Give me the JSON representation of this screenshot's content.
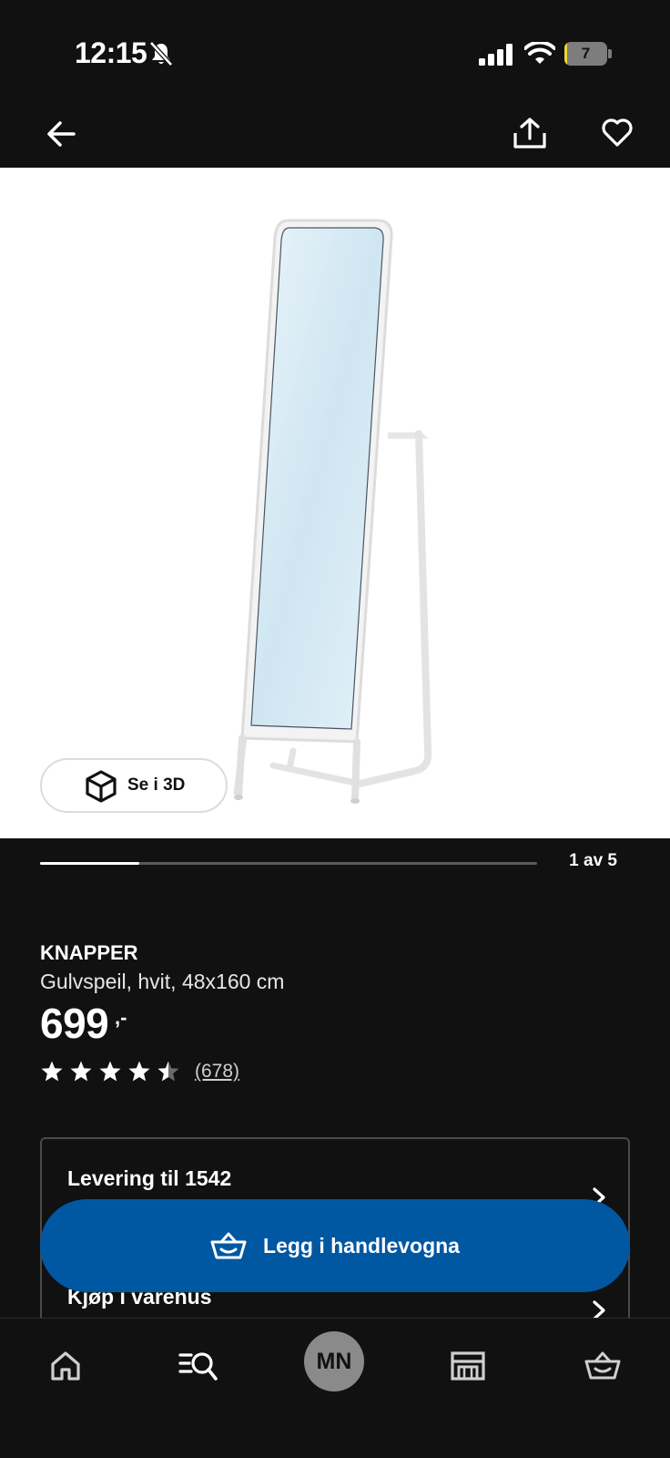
{
  "status_bar": {
    "time": "12:15",
    "battery_level": "7",
    "battery_fraction": 0.07,
    "icons": [
      "bell-off-icon",
      "signal-icon",
      "wifi-icon",
      "battery-icon"
    ]
  },
  "top_bar": {
    "icons": [
      "arrow-left-icon",
      "share-icon",
      "heart-icon"
    ]
  },
  "gallery": {
    "view_3d_label": "Se i 3D",
    "view_3d_icon": "cube-icon",
    "counter": "1 av 5",
    "progress_fraction": 0.2
  },
  "product": {
    "name": "KNAPPER",
    "description": "Gulvspeil, hvit, 48x160 cm",
    "price": "699",
    "price_suffix": ",-",
    "rating_value": 4.5,
    "rating_count": "(678)"
  },
  "availability": {
    "delivery_label": "Levering til 1542",
    "instore_label": "Kjøp i varehus"
  },
  "add_to_cart": {
    "label": "Legg i handlevogna",
    "icon": "basket-icon"
  },
  "bottom_nav": {
    "items": [
      "home-icon",
      "search-list-icon",
      "profile-avatar",
      "store-icon",
      "basket-icon"
    ],
    "avatar_initials": "MN"
  },
  "colors": {
    "background": "#111111",
    "accent_blue": "#0058a3",
    "battery_yellow": "#f1d438"
  }
}
